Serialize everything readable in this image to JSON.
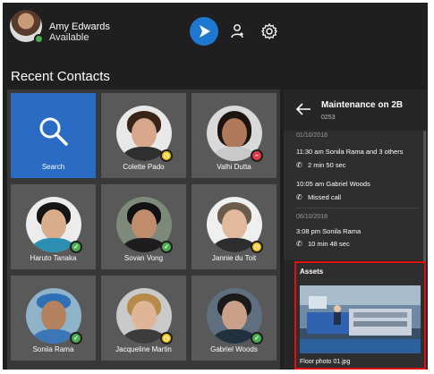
{
  "user": {
    "name": "Amy Edwards",
    "status": "Available"
  },
  "header": {
    "main_button_icon": "play-arrow-icon",
    "transfer_icon": "person-transfer-icon",
    "settings_icon": "gear-icon"
  },
  "section_title": "Recent Contacts",
  "search_tile": {
    "label": "Search"
  },
  "contacts": [
    {
      "name": "Colette Pado",
      "presence": "away"
    },
    {
      "name": "Valhi Dutta",
      "presence": "busy"
    },
    {
      "name": "Haruto Tanaka",
      "presence": "available"
    },
    {
      "name": "Sovan Vong",
      "presence": "available"
    },
    {
      "name": "Jannie du Toit",
      "presence": "away"
    },
    {
      "name": "Soniia Rama",
      "presence": "available"
    },
    {
      "name": "Jacqueline Martin",
      "presence": "away"
    },
    {
      "name": "Gabriel Woods",
      "presence": "available"
    }
  ],
  "colors": {
    "accent": "#1e78d2",
    "available": "#4caf50",
    "away": "#f5c518",
    "busy": "#e23b4b",
    "highlight": "#e01010"
  },
  "panel": {
    "title": "Maintenance on 2B",
    "subtitle": "0253",
    "feed": [
      {
        "type": "date",
        "text": "01/10/2018"
      },
      {
        "type": "entry",
        "text": "11:30 am Sonila Rama and 3 others"
      },
      {
        "type": "call",
        "text": "2 min 50 sec"
      },
      {
        "type": "entry",
        "text": "10:05 am Gabriel Woods"
      },
      {
        "type": "missed",
        "text": "Missed call"
      },
      {
        "type": "date",
        "text": "06/10/2018"
      },
      {
        "type": "entry",
        "text": "3:08 pm Sonila Rama"
      },
      {
        "type": "call",
        "text": "10 min 48 sec"
      }
    ]
  },
  "assets": {
    "title": "Assets",
    "file_label": "Floor photo 01.jpg"
  }
}
